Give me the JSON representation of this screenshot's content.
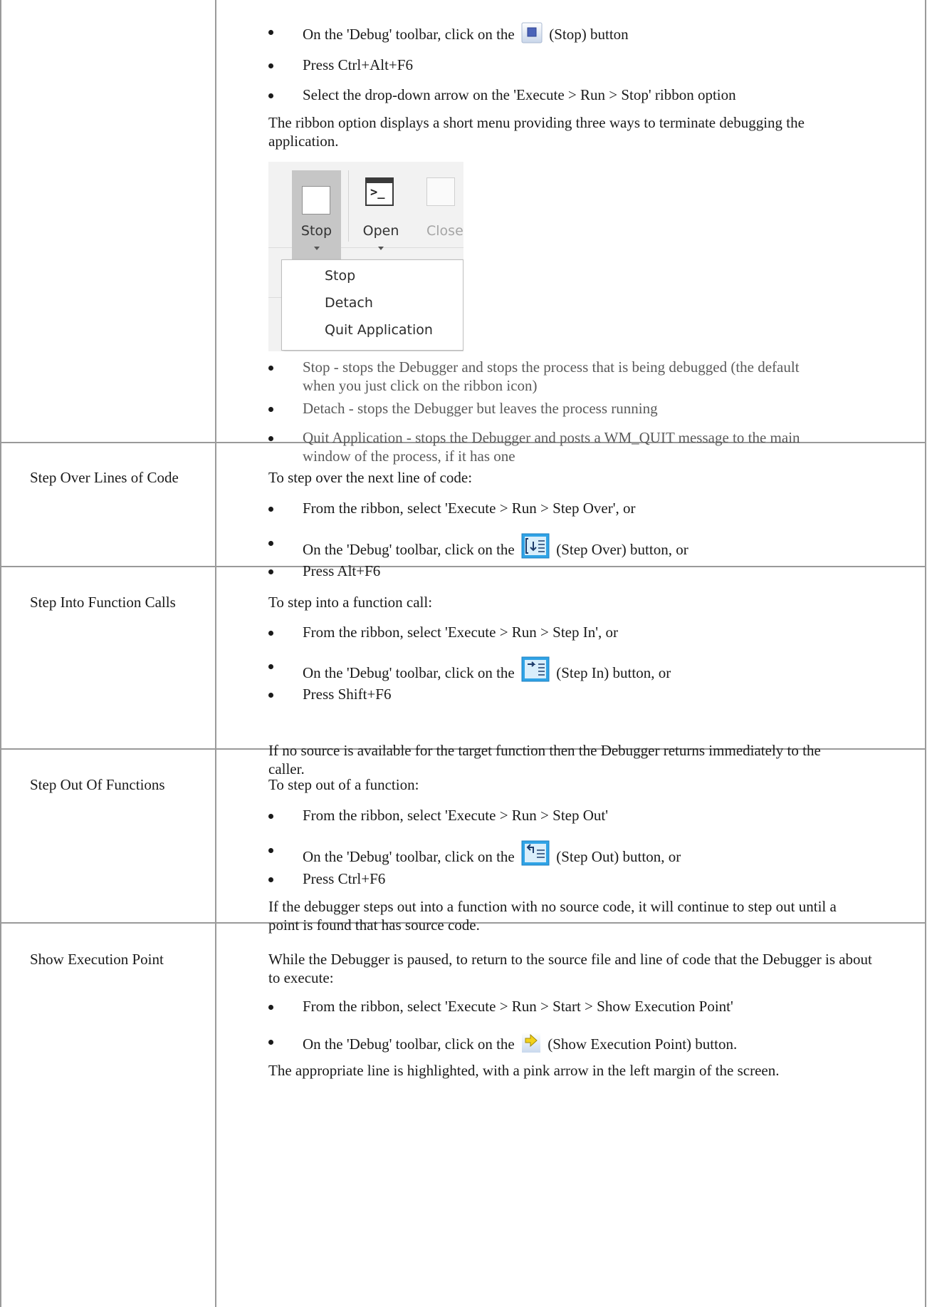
{
  "top_row": {
    "bullets_a": [
      {
        "before": "On the 'Debug' toolbar, click on the",
        "icon": "stop-icon",
        "after": "(Stop) button"
      },
      {
        "text": "Press Ctrl+Alt+F6"
      },
      {
        "text": "Select the drop-down arrow on the 'Execute > Run > Stop' ribbon option"
      }
    ],
    "paragraph": "The ribbon option displays a short menu providing three ways to terminate debugging the application.",
    "ribbon": {
      "stop_label": "Stop",
      "open_label": "Open",
      "close_label": "Close",
      "menu_items": [
        "Stop",
        "Detach",
        "Quit Application"
      ]
    },
    "bullets_b": [
      "Stop - stops the Debugger and stops the process that is being debugged (the default when you just click on the ribbon icon)",
      "Detach - stops the Debugger but leaves the process running",
      "Quit Application - stops the Debugger and posts a WM_QUIT message to the main window of the process, if it has one"
    ]
  },
  "rows": [
    {
      "label": "Step Over Lines of Code",
      "intro": "To step over the next line of code:",
      "bullets": [
        {
          "text": "From the ribbon, select 'Execute > Run > Step Over', or"
        },
        {
          "before": "On the 'Debug' toolbar, click on the",
          "icon": "step-over-icon",
          "after": "(Step Over) button, or"
        },
        {
          "text": "Press Alt+F6"
        }
      ]
    },
    {
      "label": "Step Into Function Calls",
      "intro": "To step into a function call:",
      "bullets": [
        {
          "text": "From the ribbon, select 'Execute > Run > Step In', or"
        },
        {
          "before": "On the 'Debug' toolbar, click on the",
          "icon": "step-in-icon",
          "after": "(Step In) button, or"
        },
        {
          "text": "Press Shift+F6"
        }
      ],
      "note": "If no source is available for the target function then the Debugger returns immediately to the caller."
    },
    {
      "label": "Step Out Of Functions",
      "intro": "To step out of a function:",
      "bullets": [
        {
          "text": "From the ribbon, select 'Execute > Run > Step Out'"
        },
        {
          "before": "On the 'Debug' toolbar, click on the",
          "icon": "step-out-icon",
          "after": "(Step Out) button, or"
        },
        {
          "text": "Press Ctrl+F6"
        }
      ],
      "note": "If the debugger steps out into a function with no source code, it will continue to step out until a point is found that has source code."
    },
    {
      "label": "Show Execution Point",
      "intro": "While the Debugger is paused, to return to the source file and line of code that the Debugger is about to execute:",
      "bullets": [
        {
          "text": "From the ribbon, select 'Execute > Run > Start > Show Execution Point'"
        },
        {
          "before": "On the 'Debug' toolbar, click on the",
          "icon": "show-execution-point-icon",
          "after": "(Show Execution Point) button."
        }
      ],
      "note": "The appropriate line is highlighted, with a pink arrow in the left margin of the screen."
    }
  ]
}
